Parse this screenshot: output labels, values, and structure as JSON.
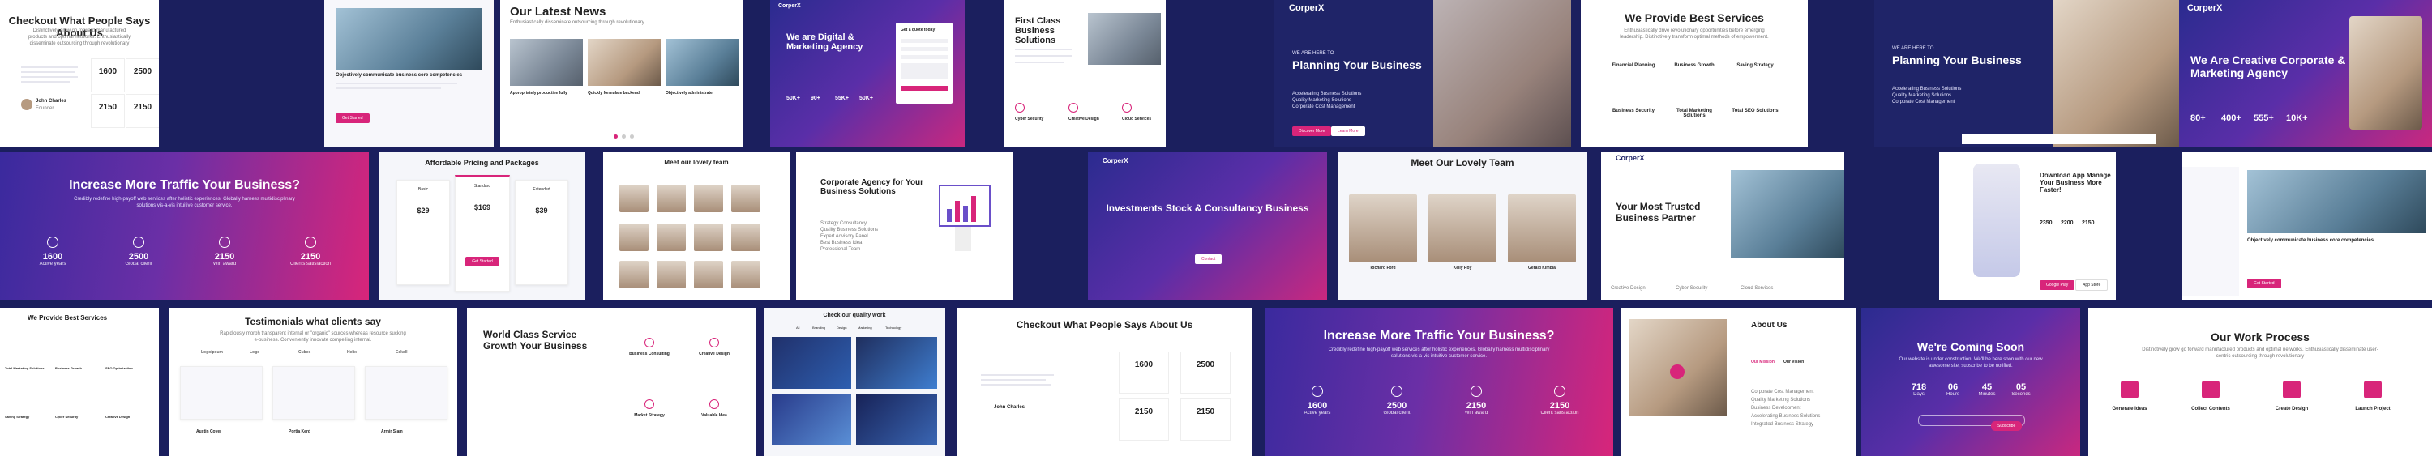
{
  "row1": {
    "t1": {
      "title": "Checkout What People Says About Us",
      "sub": "Distinctively grow go forward manufactured products and optimal networks. Enthusiastically disseminate outsourcing through revolutionary",
      "person": "John Charles",
      "role": "Founder",
      "stats": [
        "1600",
        "2500",
        "2150",
        "2150"
      ]
    },
    "t2": {
      "heading": "Objectively communicate business core competencies",
      "btn": "Get Started"
    },
    "t3": {
      "title": "Our Latest News",
      "sub": "Enthusiastically disseminate outsourcing through revolutionary",
      "cards": [
        "Appropriately productize fully",
        "Quickly formulate backend",
        "Objectively administrate"
      ]
    },
    "t4": {
      "logo": "CorperX",
      "title": "We are Digital & Marketing Agency",
      "form_title": "Get a quote today",
      "stats": [
        "50K+",
        "90+",
        "55K+",
        "50K+"
      ]
    },
    "t5": {
      "title": "First Class Business Solutions",
      "items": [
        "Cyber Security",
        "Creative Design",
        "Cloud Services"
      ]
    },
    "t6": {
      "logo": "CorperX",
      "tag": "WE ARE HERE TO",
      "title": "Planning Your Business",
      "list": [
        "Accelerating Business Solutions",
        "Quality Marketing Solutions",
        "Corporate Cost Management"
      ],
      "btn1": "Discover More",
      "btn2": "Learn More"
    },
    "t7": {
      "title": "We Provide Best Services",
      "sub": "Enthusiastically drive revolutionary opportunities before emerging leadership. Distinctively transform optimal methods of empowerment.",
      "services": [
        "Financial Planning",
        "Business Growth",
        "Saving Strategy",
        "Business Security",
        "Total Marketing Solutions",
        "Total SEO Solutions"
      ]
    },
    "t8": {
      "tag": "WE ARE HERE TO",
      "title": "Planning Your Business",
      "list": [
        "Accelerating Business Solutions",
        "Quality Marketing Solutions",
        "Corporate Cost Management"
      ]
    },
    "t9": {
      "logo": "CorperX",
      "title": "We Are Creative Corporate & Marketing Agency",
      "stats": [
        "80+",
        "400+",
        "555+",
        "10K+"
      ]
    }
  },
  "row2": {
    "t1": {
      "title": "Increase More Traffic Your Business?",
      "sub": "Credibly redefine high-payoff web services after holistic experiences. Globally harness multidisciplinary solutions vis-a-vis intuitive customer service.",
      "stats": [
        {
          "n": "1600",
          "l": "Active years"
        },
        {
          "n": "2500",
          "l": "Global client"
        },
        {
          "n": "2150",
          "l": "Win award"
        },
        {
          "n": "2150",
          "l": "Clients satisfaction"
        }
      ]
    },
    "t2": {
      "title": "Affordable Pricing and Packages",
      "plans": [
        "Basic",
        "Standard",
        "Extended"
      ],
      "prices": [
        "$29",
        "$169",
        "$39"
      ],
      "btn": "Get Started"
    },
    "t3": {
      "title": "Meet our lovely team"
    },
    "t4": {
      "title": "Corporate Agency for Your Business Solutions",
      "list": [
        "Strategy Consultancy",
        "Quality Business Solutions",
        "Expert Advisory Panel",
        "Best Business Idea",
        "Professional Team"
      ]
    },
    "t5": {
      "logo": "CorperX",
      "title": "Investments Stock & Consultancy Business",
      "btn": "Contact"
    },
    "t6": {
      "title": "Meet Our Lovely Team",
      "names": [
        "Richard Ford",
        "Kelly Roy",
        "Gerald Kimbla"
      ]
    },
    "t7": {
      "logo": "CorperX",
      "title": "Your Most Trusted Business Partner",
      "icons": [
        "Creative Design",
        "Cyber Security",
        "Cloud Services"
      ]
    },
    "t8": {
      "title": "Download App Manage Your Business More Faster!",
      "stats": [
        "2350",
        "2200",
        "2150"
      ],
      "btn1": "Google Play",
      "btn2": "App Store"
    },
    "t9": {
      "heading": "Objectively communicate business core competencies",
      "btn": "Get Started"
    }
  },
  "row3": {
    "t1": {
      "title": "We Provide Best Services",
      "services": [
        "Total Marketing Solutions",
        "Business Growth",
        "SEO Optimization",
        "Saving Strategy",
        "Cyber Security",
        "Creative Design"
      ]
    },
    "t2": {
      "title": "Testimonials what clients say",
      "sub": "Rapidiously morph transparent internal or \"organic\" sources whereas resource sucking e-business. Conveniently innovate compelling internal.",
      "brands": [
        "Logoipsum",
        "Logo",
        "Cubes",
        "Helix",
        "Eckell"
      ],
      "people": [
        "Austin Cover",
        "Portia Kerd",
        "Armir Siam"
      ]
    },
    "t3": {
      "title": "World Class Service Growth Your Business",
      "items": [
        "Business Consulting",
        "Creative Design",
        "Market Strategy",
        "Valuable Idea"
      ]
    },
    "t4": {
      "title": "Check our quality work",
      "tabs": [
        "All",
        "Branding",
        "Design",
        "Marketing",
        "Technology"
      ]
    },
    "t5": {
      "title": "Checkout What People Says About Us",
      "person": "John Charles",
      "stats": [
        "1600",
        "2500",
        "2150",
        "2150"
      ]
    },
    "t6": {
      "title": "Increase More Traffic Your Business?",
      "sub": "Credibly redefine high-payoff web services after holistic experiences. Globally harness multidisciplinary solutions vis-a-vis intuitive customer service.",
      "stats": [
        {
          "n": "1600",
          "l": "Active years"
        },
        {
          "n": "2500",
          "l": "Global client"
        },
        {
          "n": "2150",
          "l": "Win award"
        },
        {
          "n": "2150",
          "l": "Client satisfaction"
        }
      ]
    },
    "t7": {
      "title": "About Us",
      "tabs": [
        "Our Mission",
        "Our Vision"
      ],
      "list": [
        "Corporate Cost Management",
        "Quality Marketing Solutions",
        "Business Development",
        "Accelerating Business Solutions",
        "Integrated Business Strategy"
      ]
    },
    "t8": {
      "title": "We're Coming Soon",
      "sub": "Our website is under construction. We'll be here soon with our new awesome site, subscribe to be notified.",
      "countdown": [
        {
          "n": "718",
          "l": "Days"
        },
        {
          "n": "06",
          "l": "Hours"
        },
        {
          "n": "45",
          "l": "Minutes"
        },
        {
          "n": "05",
          "l": "Seconds"
        }
      ],
      "btn": "Subscribe"
    },
    "t9": {
      "title": "Our Work Process",
      "sub": "Distinctively grow go forward manufactured products and optimal networks. Enthusiastically disseminate user-centric outsourcing through revolutionary",
      "steps": [
        "Generate Ideas",
        "Collect Contents",
        "Create Design",
        "Launch Project"
      ]
    }
  },
  "colors": {
    "pink": "#d8257a",
    "navy": "#1f2468",
    "purple": "#5a2ea8"
  }
}
